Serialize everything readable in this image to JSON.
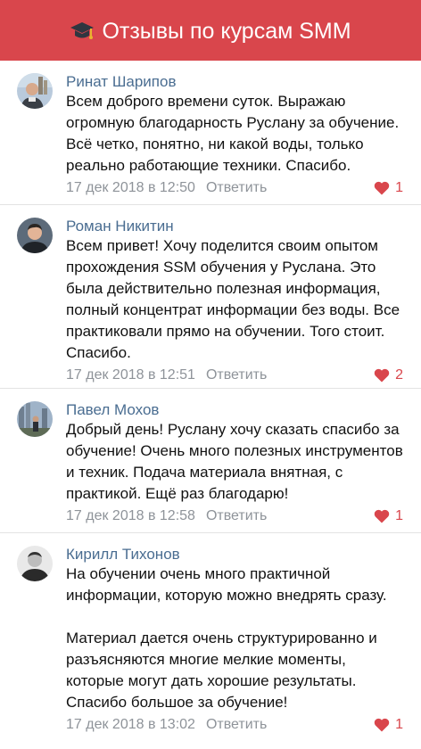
{
  "header": {
    "title": "Отзывы по курсам SMM",
    "icon": "graduation-cap-icon",
    "color": "#d9464c"
  },
  "comments": [
    {
      "author": "Ринат Шарипов",
      "text": "Всем доброго времени суток. Выражаю огромную благодарность Руслану за обучение. Всё четко, понятно, ни какой воды, только реально работающие техники. Спасибо.",
      "date": "17 дек 2018 в 12:50",
      "reply": "Ответить",
      "likes": "1"
    },
    {
      "author": "Роман Никитин",
      "text": "Всем привет! Хочу поделится своим опытом прохождения SSM обучения у Руслана. Это была действительно полезная информация, полный концентрат информации без воды. Все практиковали прямо на обучении. Того стоит. Спасибо.",
      "date": "17 дек 2018 в 12:51",
      "reply": "Ответить",
      "likes": "2"
    },
    {
      "author": "Павел Мохов",
      "text": "Добрый день! Руслану хочу сказать спасибо за обучение! Очень много полезных инструментов  и техник. Подача материала внятная, с практикой. Ещё раз благодарю!",
      "date": "17 дек 2018 в 12:58",
      "reply": "Ответить",
      "likes": "1"
    },
    {
      "author": "Кирилл Тихонов",
      "text": "На обучении очень много практичной информации, которую можно внедрять сразу.\n\nМатериал дается очень структурированно и разъясняются многие мелкие моменты, которые могут дать хорошие результаты. Спасибо большое за обучение!",
      "date": "17 дек 2018 в 13:02",
      "reply": "Ответить",
      "likes": "1"
    }
  ]
}
